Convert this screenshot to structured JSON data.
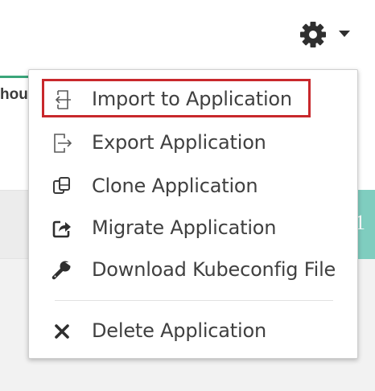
{
  "background": {
    "tab_text": "hou",
    "right_cell_text": "1"
  },
  "header": {
    "settings_icon": "gear-icon",
    "dropdown_icon": "caret-down-icon"
  },
  "menu": {
    "items": [
      {
        "label": "Import to Application",
        "icon": "import-icon",
        "highlighted": true
      },
      {
        "label": "Export Application",
        "icon": "export-icon"
      },
      {
        "label": "Clone Application",
        "icon": "clone-icon"
      },
      {
        "label": "Migrate Application",
        "icon": "migrate-icon"
      },
      {
        "label": "Download Kubeconfig File",
        "icon": "wrench-icon"
      },
      {
        "label": "Delete Application",
        "icon": "close-icon"
      }
    ]
  },
  "colors": {
    "highlight_border": "#c8282c",
    "accent_green": "#3aa57a",
    "accent_teal": "#7fcdbf",
    "text": "#404040"
  }
}
